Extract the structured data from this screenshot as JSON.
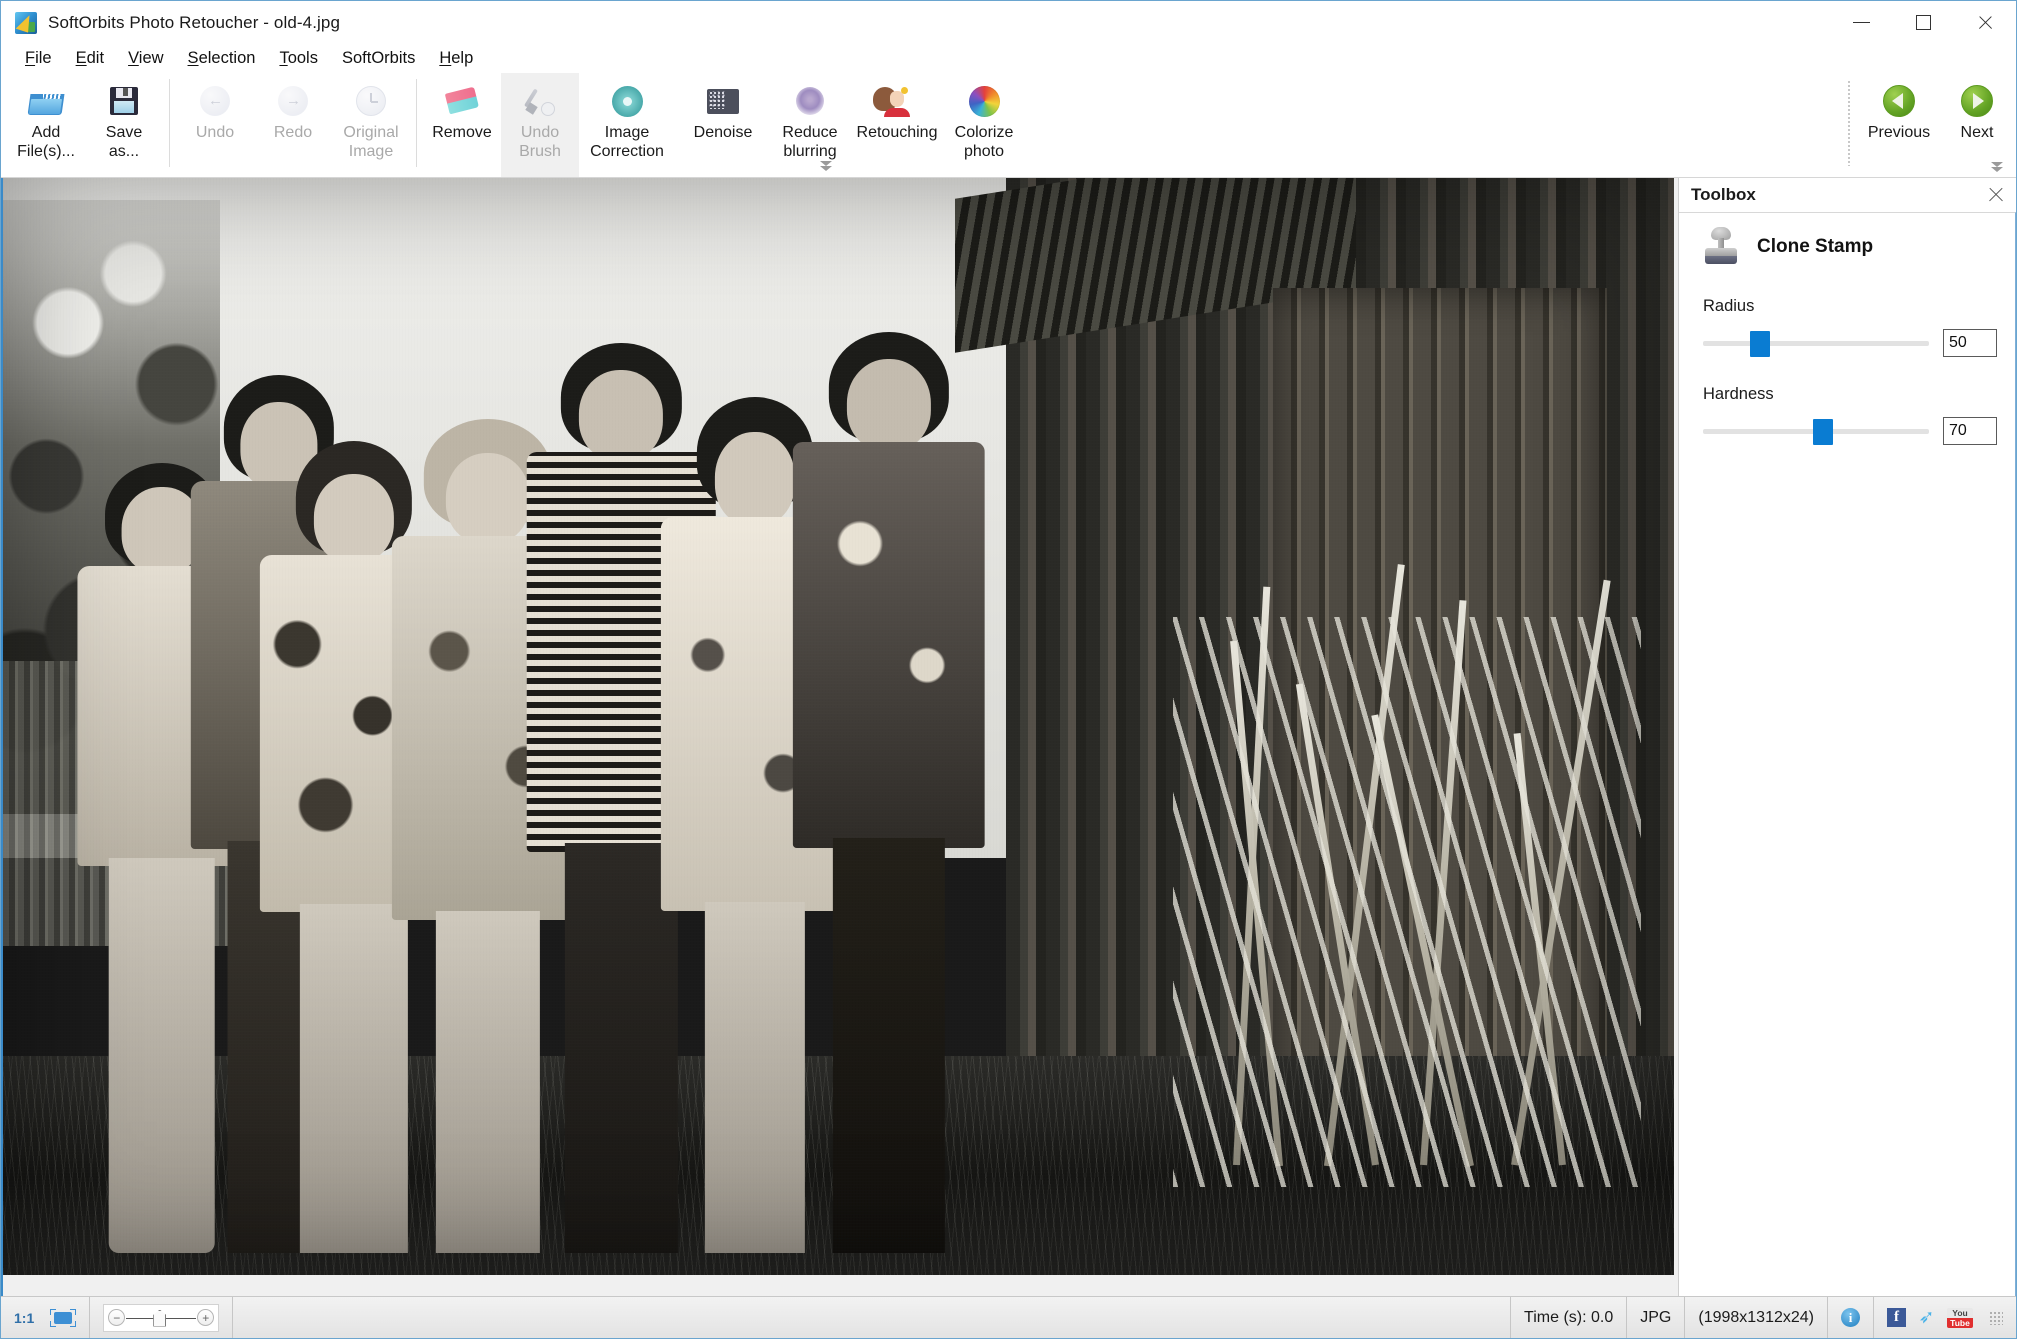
{
  "window": {
    "title": "SoftOrbits Photo Retoucher - old-4.jpg",
    "logo_icon": "app-logo-icon",
    "minimize_label": "Minimize",
    "maximize_label": "Maximize",
    "close_label": "Close"
  },
  "menubar": {
    "items": [
      {
        "label": "File",
        "accel": "F"
      },
      {
        "label": "Edit",
        "accel": "E"
      },
      {
        "label": "View",
        "accel": "V"
      },
      {
        "label": "Selection",
        "accel": "S"
      },
      {
        "label": "Tools",
        "accel": "T"
      },
      {
        "label": "SoftOrbits",
        "accel": ""
      },
      {
        "label": "Help",
        "accel": "H"
      }
    ]
  },
  "toolbar": {
    "buttons": [
      {
        "name": "add-files",
        "line1": "Add",
        "line2": "File(s)...",
        "icon": "folder-icon",
        "disabled": false,
        "selected": false
      },
      {
        "name": "save-as",
        "line1": "Save",
        "line2": "as...",
        "icon": "floppy-disk-icon",
        "disabled": false,
        "selected": false
      },
      {
        "name": "undo",
        "line1": "Undo",
        "line2": "",
        "icon": "undo-arrow-icon",
        "disabled": true,
        "selected": false
      },
      {
        "name": "redo",
        "line1": "Redo",
        "line2": "",
        "icon": "redo-arrow-icon",
        "disabled": true,
        "selected": false
      },
      {
        "name": "original-image",
        "line1": "Original",
        "line2": "Image",
        "icon": "clock-revert-icon",
        "disabled": true,
        "selected": false
      },
      {
        "name": "remove",
        "line1": "Remove",
        "line2": "",
        "icon": "eraser-icon",
        "disabled": false,
        "selected": false
      },
      {
        "name": "undo-brush",
        "line1": "Undo",
        "line2": "Brush",
        "icon": "brush-revert-icon",
        "disabled": true,
        "selected": true
      },
      {
        "name": "image-correction",
        "line1": "Image",
        "line2": "Correction",
        "icon": "flower-burst-icon",
        "disabled": false,
        "selected": false
      },
      {
        "name": "denoise",
        "line1": "Denoise",
        "line2": "",
        "icon": "noise-icon",
        "disabled": false,
        "selected": false
      },
      {
        "name": "reduce-blurring",
        "line1": "Reduce",
        "line2": "blurring",
        "icon": "blur-dot-icon",
        "disabled": false,
        "selected": false
      },
      {
        "name": "retouching",
        "line1": "Retouching",
        "line2": "",
        "icon": "woman-portrait-icon",
        "disabled": false,
        "selected": false
      },
      {
        "name": "colorize-photo",
        "line1": "Colorize",
        "line2": "photo",
        "icon": "color-wheel-icon",
        "disabled": false,
        "selected": false
      }
    ],
    "nav": [
      {
        "name": "previous",
        "label": "Previous",
        "icon": "green-left-arrow-icon"
      },
      {
        "name": "next",
        "label": "Next",
        "icon": "green-right-arrow-icon"
      }
    ],
    "expander_icon": "double-chevron-down-icon"
  },
  "toolbox": {
    "panel_title": "Toolbox",
    "close_icon": "close-icon",
    "tool_icon": "clone-stamp-icon",
    "tool_name": "Clone Stamp",
    "fields": [
      {
        "name": "radius",
        "label": "Radius",
        "value": "50",
        "percent": 25
      },
      {
        "name": "hardness",
        "label": "Hardness",
        "value": "70",
        "percent": 53
      }
    ],
    "accent_color": "#0a7cd2"
  },
  "canvas": {
    "image_alt": "old-4.jpg — vintage black and white group photograph of eight people standing in front of a wooden shed"
  },
  "statusbar": {
    "zoom_ratio": "1:1",
    "fit_icon": "fit-to-window-icon",
    "zoom_out_icon": "zoom-out-icon",
    "zoom_in_icon": "zoom-in-icon",
    "zoom_slider_percent": 47,
    "time_label": "Time (s): 0.0",
    "format_label": "JPG",
    "dimensions_label": "(1998x1312x24)",
    "info_icon": "info-icon",
    "info_glyph": "i",
    "social": [
      {
        "name": "facebook-icon",
        "glyph": "f"
      },
      {
        "name": "twitter-icon",
        "glyph": "❦"
      },
      {
        "name": "youtube-icon",
        "line1": "You",
        "line2": "Tube"
      }
    ]
  }
}
